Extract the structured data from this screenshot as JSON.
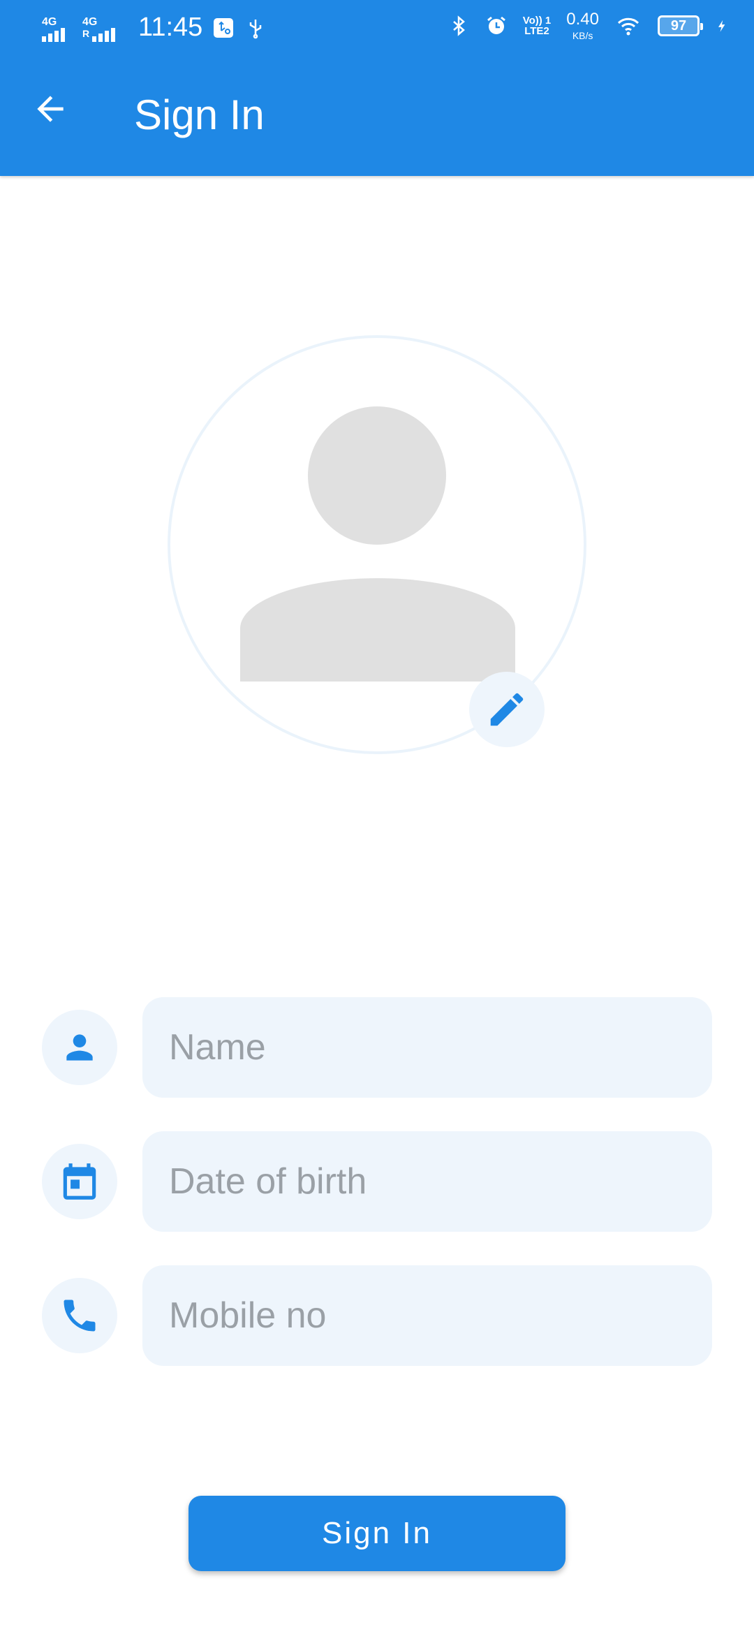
{
  "status_bar": {
    "network_1": "4G",
    "network_2": "4G",
    "network_2_sub": "R",
    "time": "11:45",
    "volte_top": "Vo)) 1",
    "volte_bottom": "LTE2",
    "speed_value": "0.40",
    "speed_unit": "KB/s",
    "battery_level": "97",
    "icons": [
      "usb-debug-icon",
      "usb-icon",
      "bluetooth-icon",
      "alarm-icon",
      "wifi-icon",
      "battery-icon",
      "charging-icon"
    ]
  },
  "toolbar": {
    "back_icon": "arrow-back-icon",
    "title": "Sign In"
  },
  "avatar": {
    "placeholder_icon": "person-silhouette",
    "edit_icon": "pencil-icon"
  },
  "form": {
    "fields": [
      {
        "icon": "person-icon",
        "placeholder": "Name",
        "value": ""
      },
      {
        "icon": "calendar-icon",
        "placeholder": "Date of birth",
        "value": ""
      },
      {
        "icon": "phone-icon",
        "placeholder": "Mobile no",
        "value": ""
      }
    ],
    "submit_label": "Sign In"
  },
  "colors": {
    "primary": "#1f88e5",
    "field_background": "#eef5fc",
    "placeholder_text": "#9aa0a6",
    "avatar_gray": "#e0e0e0"
  }
}
